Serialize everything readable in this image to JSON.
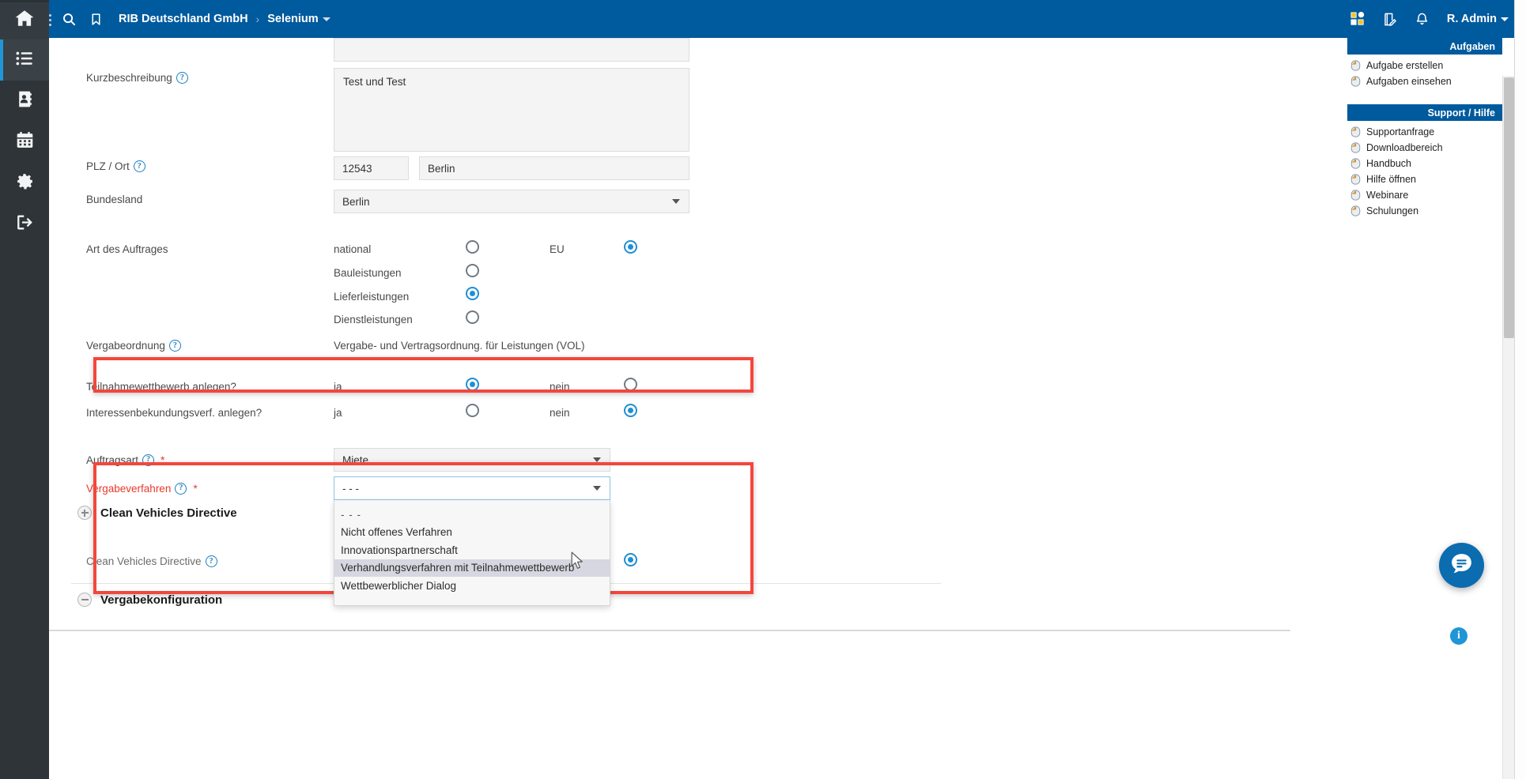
{
  "window": {
    "left_rail": {
      "items": [
        {
          "name": "home",
          "icon": "home-icon",
          "active": false
        },
        {
          "name": "projects",
          "icon": "list-icon",
          "active": true
        },
        {
          "name": "contacts",
          "icon": "address-book-icon",
          "active": false
        },
        {
          "name": "calendar",
          "icon": "calendar-icon",
          "active": false
        },
        {
          "name": "settings",
          "icon": "gear-icon",
          "active": false
        },
        {
          "name": "logout",
          "icon": "logout-icon",
          "active": false
        }
      ]
    },
    "topbar": {
      "search_icon": "search-icon",
      "bookmark_icon": "bookmark-icon",
      "breadcrumb": {
        "org": "RIB Deutschland GmbH",
        "separator": "›",
        "project": "Selenium"
      },
      "apps_icon": "apps-grid-icon",
      "notes_icon": "note-edit-icon",
      "bell_icon": "bell-icon",
      "user": "R. Admin",
      "accent_color": "#005a9e"
    }
  },
  "form": {
    "kurzbeschreibung": {
      "label": "Kurzbeschreibung",
      "help_icon": "question-icon",
      "value": "Test und Test"
    },
    "plz_ort": {
      "label": "PLZ / Ort",
      "help_icon": "question-icon",
      "plz_value": "12543",
      "ort_value": "Berlin"
    },
    "bundesland": {
      "label": "Bundesland",
      "value": "Berlin"
    },
    "art_des_auftrages": {
      "label": "Art des Auftrages",
      "options": [
        {
          "label": "national",
          "selected": false
        },
        {
          "label": "EU",
          "selected": true
        },
        {
          "label": "Bauleistungen",
          "selected": false
        },
        {
          "label": "Lieferleistungen",
          "selected": true
        },
        {
          "label": "Dienstleistungen",
          "selected": false
        }
      ]
    },
    "vergabeordnung": {
      "label": "Vergabeordnung",
      "help_icon": "question-icon",
      "value": "Vergabe- und Vertragsordnung. für Leistungen (VOL)"
    },
    "teilnahmewettbewerb": {
      "label": "Teilnahmewettbewerb anlegen?",
      "yes_label": "ja",
      "no_label": "nein",
      "yes_selected": true,
      "no_selected": false,
      "highlighted": true
    },
    "interessenbekundung": {
      "label": "Interessenbekundungsverf. anlegen?",
      "yes_label": "ja",
      "no_label": "nein",
      "yes_selected": false,
      "no_selected": true
    },
    "auftragsart": {
      "label": "Auftragsart",
      "help_icon": "question-icon",
      "required_mark": "*",
      "value": "Miete"
    },
    "vergabeverfahren": {
      "label": "Vergabeverfahren",
      "help_icon": "question-icon",
      "required_mark": "*",
      "value": "- - -",
      "highlighted": true,
      "expanded": true,
      "options": [
        {
          "label": "- - -",
          "hovered": false
        },
        {
          "label": "Nicht offenes Verfahren",
          "hovered": false
        },
        {
          "label": "Innovationspartnerschaft",
          "hovered": false
        },
        {
          "label": "Verhandlungsverfahren mit Teilnahmewettbewerb",
          "hovered": true
        },
        {
          "label": "Wettbewerblicher Dialog",
          "hovered": false
        }
      ]
    },
    "clean_vehicles_section": {
      "title": "Clean Vehicles Directive",
      "toggle_icon": "plus-circle-icon",
      "field_label": "Clean Vehicles Directive",
      "help_icon": "question-icon",
      "radio_selected": true
    },
    "vergabekonfiguration_section": {
      "title": "Vergabekonfiguration",
      "toggle_icon": "minus-circle-icon"
    },
    "highlight_color": "#f4463c"
  },
  "right_panel": {
    "groups": [
      {
        "title": "Aufgaben",
        "items": [
          {
            "label": "Aufgabe erstellen",
            "icon": "mouse-click-icon"
          },
          {
            "label": "Aufgaben einsehen",
            "icon": "mouse-click-icon"
          }
        ]
      },
      {
        "title": "Support / Hilfe",
        "items": [
          {
            "label": "Supportanfrage",
            "icon": "mouse-click-icon"
          },
          {
            "label": "Downloadbereich",
            "icon": "mouse-click-icon"
          },
          {
            "label": "Handbuch",
            "icon": "mouse-click-icon"
          },
          {
            "label": "Hilfe öffnen",
            "icon": "mouse-click-icon"
          },
          {
            "label": "Webinare",
            "icon": "mouse-click-icon"
          },
          {
            "label": "Schulungen",
            "icon": "mouse-click-icon"
          }
        ]
      }
    ]
  },
  "widgets": {
    "chat_icon": "chat-bubble-icon",
    "info_icon": "info-icon",
    "info_label": "i"
  }
}
